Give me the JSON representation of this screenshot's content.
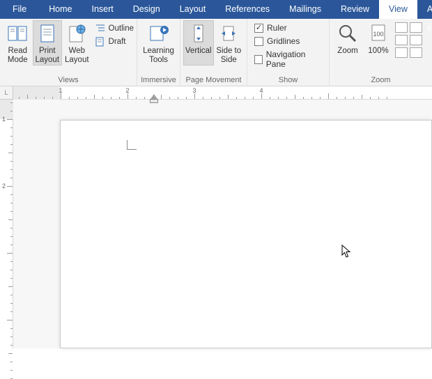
{
  "tabs": {
    "file": "File",
    "home": "Home",
    "insert": "Insert",
    "design": "Design",
    "layout": "Layout",
    "references": "References",
    "mailings": "Mailings",
    "review": "Review",
    "view": "View",
    "addins": "Add-in"
  },
  "ribbon": {
    "views": {
      "label": "Views",
      "read": "Read Mode",
      "print": "Print Layout",
      "web": "Web Layout",
      "outline": "Outline",
      "draft": "Draft"
    },
    "immersive": {
      "label": "Immersive",
      "learning": "Learning Tools"
    },
    "pagemove": {
      "label": "Page Movement",
      "vertical": "Vertical",
      "side": "Side to Side"
    },
    "show": {
      "label": "Show",
      "ruler": "Ruler",
      "gridlines": "Gridlines",
      "navpane": "Navigation Pane"
    },
    "zoom": {
      "label": "Zoom",
      "zoom": "Zoom",
      "pct": "100%"
    }
  },
  "ruler": {
    "corner": "L",
    "h_numbers": [
      "1",
      "2",
      "3",
      "4"
    ],
    "v_numbers": [
      "1",
      "2"
    ]
  }
}
